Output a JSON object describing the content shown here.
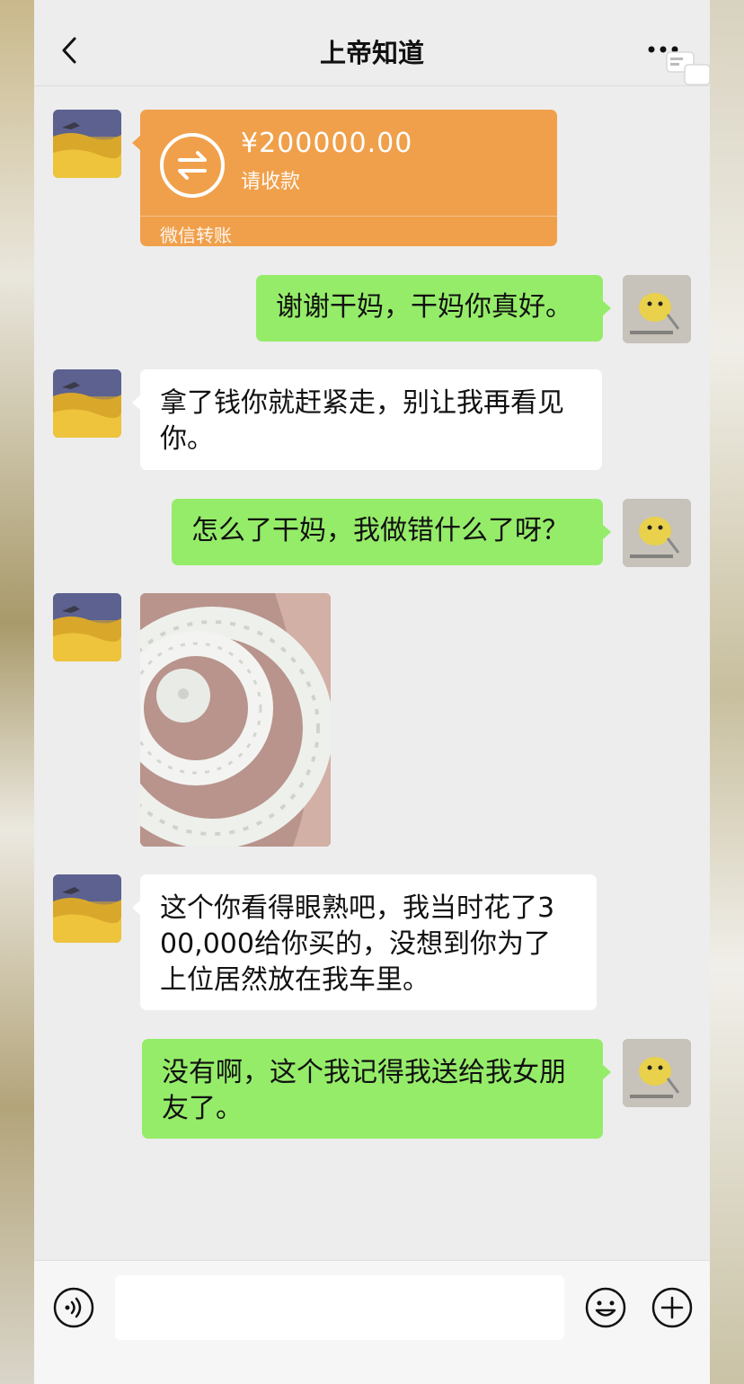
{
  "header": {
    "title": "上帝知道",
    "back_icon": "chevron-left-icon",
    "more_icon": "more-dots-icon"
  },
  "messages": [
    {
      "side": "left",
      "type": "transfer",
      "amount": "¥200000.00",
      "note": "请收款",
      "footer": "微信转账"
    },
    {
      "side": "right",
      "type": "text",
      "text": "谢谢干妈，干妈你真好。"
    },
    {
      "side": "left",
      "type": "text",
      "lines": [
        "拿了钱你就赶紧走，别让我再看见",
        "你。"
      ]
    },
    {
      "side": "right",
      "type": "text",
      "text": "怎么了干妈，我做错什么了呀？"
    },
    {
      "side": "left",
      "type": "image",
      "image_subject": "white jade bangle"
    },
    {
      "side": "left",
      "type": "text",
      "lines": [
        "这个你看得眼熟吧，我当时花了3",
        "00,000给你买的，没想到你为了",
        "上位居然放在我车里。"
      ]
    },
    {
      "side": "right",
      "type": "text",
      "lines": [
        "没有啊，这个我记得我送给我女朋",
        "友了。"
      ]
    }
  ],
  "input_bar": {
    "voice_icon": "voice-icon",
    "emoji_icon": "emoji-icon",
    "plus_icon": "plus-icon",
    "input_value": ""
  },
  "colors": {
    "chat_bg": "#ededed",
    "green_bubble": "#95ec69",
    "transfer": "#f0a04b"
  }
}
